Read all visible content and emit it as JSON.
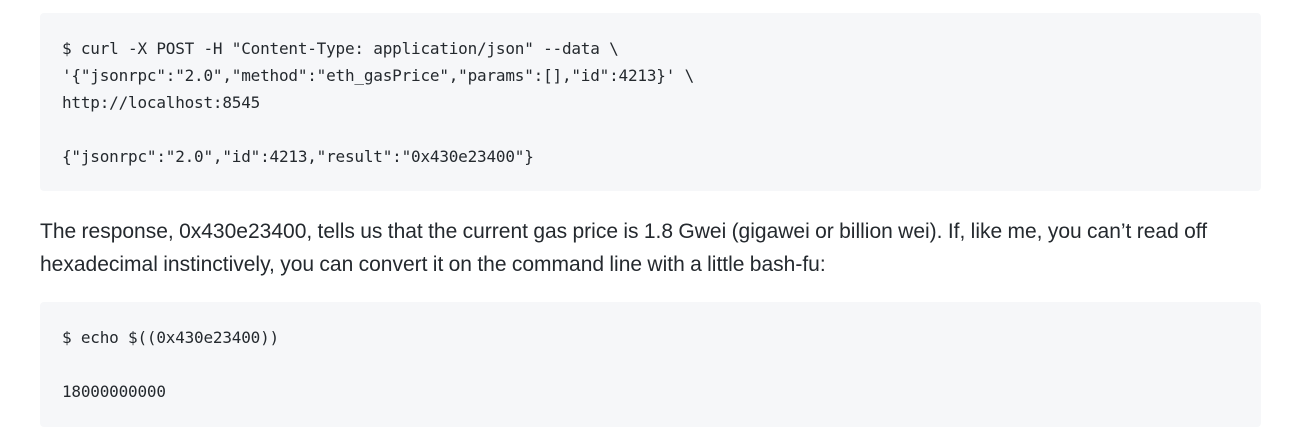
{
  "code_block_1": {
    "lines": [
      "$ curl -X POST -H \"Content-Type: application/json\" --data \\",
      "'{\"jsonrpc\":\"2.0\",\"method\":\"eth_gasPrice\",\"params\":[],\"id\":4213}' \\",
      "http://localhost:8545",
      "",
      "{\"jsonrpc\":\"2.0\",\"id\":4213,\"result\":\"0x430e23400\"}"
    ]
  },
  "paragraph": {
    "text": "The response, 0x430e23400, tells us that the current gas price is 1.8 Gwei (gigawei or billion wei). If, like me, you can’t read off hexadecimal instinctively, you can convert it on the command line with a little bash-fu:"
  },
  "code_block_2": {
    "lines": [
      "$ echo $((0x430e23400))",
      "",
      "18000000000"
    ]
  }
}
